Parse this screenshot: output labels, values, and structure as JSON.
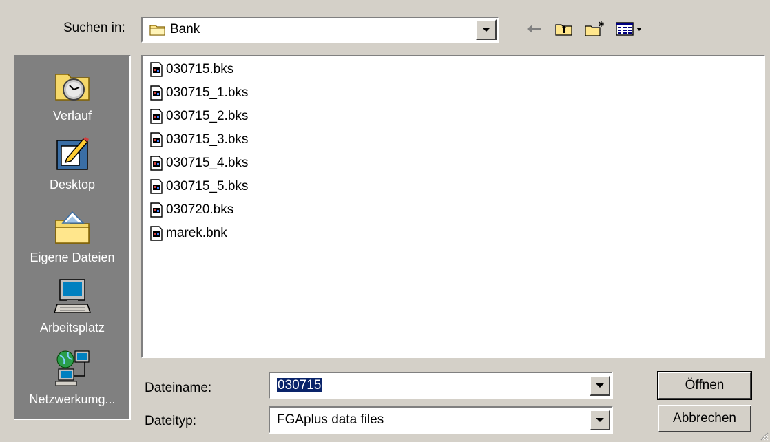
{
  "lookin": {
    "label": "Suchen in:",
    "value": "Bank"
  },
  "toolbar": {
    "back_icon": "back-arrow-icon",
    "up_icon": "folder-up-icon",
    "new_folder_icon": "new-folder-icon",
    "view_icon": "view-menu-icon"
  },
  "places": [
    {
      "label": "Verlauf",
      "icon": "history-icon"
    },
    {
      "label": "Desktop",
      "icon": "desktop-icon"
    },
    {
      "label": "Eigene Dateien",
      "icon": "my-documents-icon"
    },
    {
      "label": "Arbeitsplatz",
      "icon": "my-computer-icon"
    },
    {
      "label": "Netzwerkumg...",
      "icon": "network-icon"
    }
  ],
  "files": [
    "030715.bks",
    "030715_1.bks",
    "030715_2.bks",
    "030715_3.bks",
    "030715_4.bks",
    "030715_5.bks",
    "030720.bks",
    "marek.bnk"
  ],
  "filename": {
    "label": "Dateiname:",
    "value": "030715"
  },
  "filetype": {
    "label": "Dateityp:",
    "value": "FGAplus data files"
  },
  "buttons": {
    "open": "Öffnen",
    "cancel": "Abbrechen"
  },
  "colors": {
    "face": "#d4d0c8",
    "places_bg": "#808080",
    "selection": "#0a246a"
  }
}
